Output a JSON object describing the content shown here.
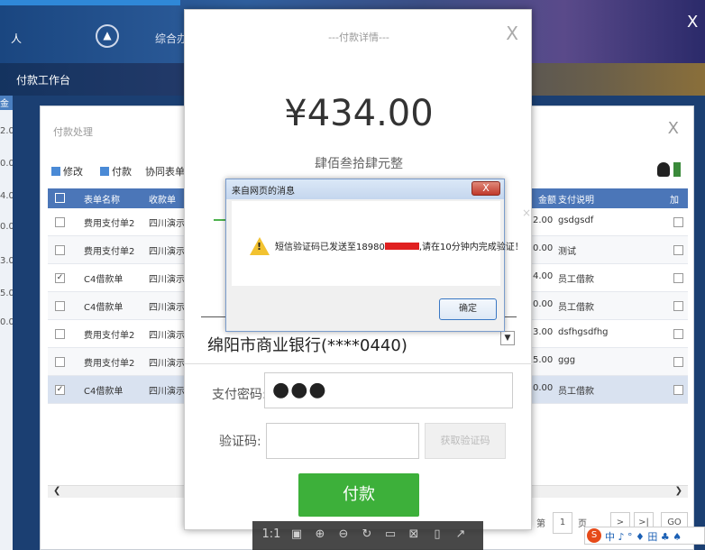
{
  "app": {
    "top_text_left": "人",
    "top_text_center": "综合办",
    "nav_icon": "navigation-arrow-icon",
    "close_glyph": "X",
    "section_label": "付款工作台",
    "left_strip_header": "金",
    "left_strip_values": [
      "2.0",
      "0.0",
      "4.0",
      "0.0",
      "3.0",
      "5.0",
      "0.0"
    ]
  },
  "list_dialog": {
    "title": "付款处理",
    "close_glyph": "X",
    "toolbar": {
      "edit_label": "修改",
      "pay_label": "付款",
      "form_label": "协同表单"
    },
    "columns": {
      "name": "表单名称",
      "unit": "收款单",
      "amount": "金额",
      "desc": "支付说明",
      "extra": "加"
    },
    "rows": [
      {
        "checked": false,
        "name": "费用支付单2",
        "unit": "四川演示",
        "amount": "2.00",
        "desc": "gsdgsdf"
      },
      {
        "checked": false,
        "name": "费用支付单2",
        "unit": "四川演示",
        "amount": "0.00",
        "desc": "测试"
      },
      {
        "checked": true,
        "name": "C4借款单",
        "unit": "四川演示",
        "amount": "4.00",
        "desc": "员工借款"
      },
      {
        "checked": false,
        "name": "C4借款单",
        "unit": "四川演示",
        "amount": "0.00",
        "desc": "员工借款"
      },
      {
        "checked": false,
        "name": "费用支付单2",
        "unit": "四川演示",
        "amount": "3.00",
        "desc": "dsfhgsdfhg"
      },
      {
        "checked": false,
        "name": "费用支付单2",
        "unit": "四川演示",
        "amount": "5.00",
        "desc": "ggg"
      },
      {
        "checked": true,
        "name": "C4借款单",
        "unit": "四川演示",
        "amount": "0.00",
        "desc": "员工借款"
      }
    ],
    "pager": {
      "page_prefix": "第",
      "page_num": "1",
      "page_suffix": "页",
      "next": ">",
      "last": ">|",
      "go": "GO"
    }
  },
  "pay_dialog": {
    "title": "---付款详情---",
    "close_glyph": "X",
    "amount": "¥434.00",
    "amount_chinese": "肆佰叁拾肆元整",
    "bank_account": "绵阳市商业银行(****0440)",
    "password_label": "支付密码:",
    "password_value": "●●●",
    "code_label": "验证码:",
    "code_value": "",
    "get_code_button": "获取验证码",
    "pay_button": "付款",
    "inner_close": "×"
  },
  "alert": {
    "title": "来自网页的消息",
    "close_glyph": "X",
    "message_prefix": "短信验证码已发送至18980",
    "message_suffix": ",请在10分钟内完成验证！",
    "ok_button": "确定"
  },
  "viewer_toolbar": [
    "1:1",
    "▣",
    "⊕",
    "⊖",
    "↻",
    "▭",
    "⊠",
    "▯",
    "↗"
  ],
  "ime": {
    "logo": "S",
    "text": "中 ♪ ° ♦ 田 ♣ ♠"
  },
  "colors": {
    "pay_button": "#3db03a",
    "table_header": "#4b76b8",
    "alert_close": "#c0392b",
    "warning": "#f2c230"
  }
}
